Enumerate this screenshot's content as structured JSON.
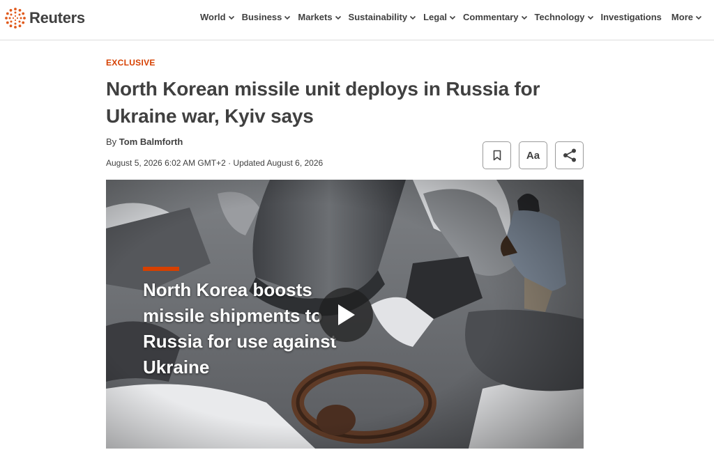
{
  "brand": {
    "name": "Reuters",
    "accent": "#d64000"
  },
  "nav": {
    "items": [
      {
        "label": "World",
        "has_dropdown": true
      },
      {
        "label": "Business",
        "has_dropdown": true
      },
      {
        "label": "Markets",
        "has_dropdown": true
      },
      {
        "label": "Sustainability",
        "has_dropdown": true
      },
      {
        "label": "Legal",
        "has_dropdown": true
      },
      {
        "label": "Commentary",
        "has_dropdown": true
      },
      {
        "label": "Technology",
        "has_dropdown": true
      },
      {
        "label": "Investigations",
        "has_dropdown": false
      },
      {
        "label": "More",
        "has_dropdown": true
      }
    ]
  },
  "article": {
    "kicker": "EXCLUSIVE",
    "headline": "North Korean missile unit deploys in Russia for Ukraine war, Kyiv says",
    "byline_prefix": "By",
    "author": "Tom Balmforth",
    "dateline": "August 5, 2026 6:02 AM GMT+2 · Updated August 6, 2026"
  },
  "tools": {
    "bookmark_icon": "bookmark-icon",
    "text_size_label": "Aa",
    "share_icon": "share-icon"
  },
  "video": {
    "overlay_title": "North Korea boosts missile shipments to Russia for use against Ukraine",
    "play_icon": "play-icon"
  }
}
